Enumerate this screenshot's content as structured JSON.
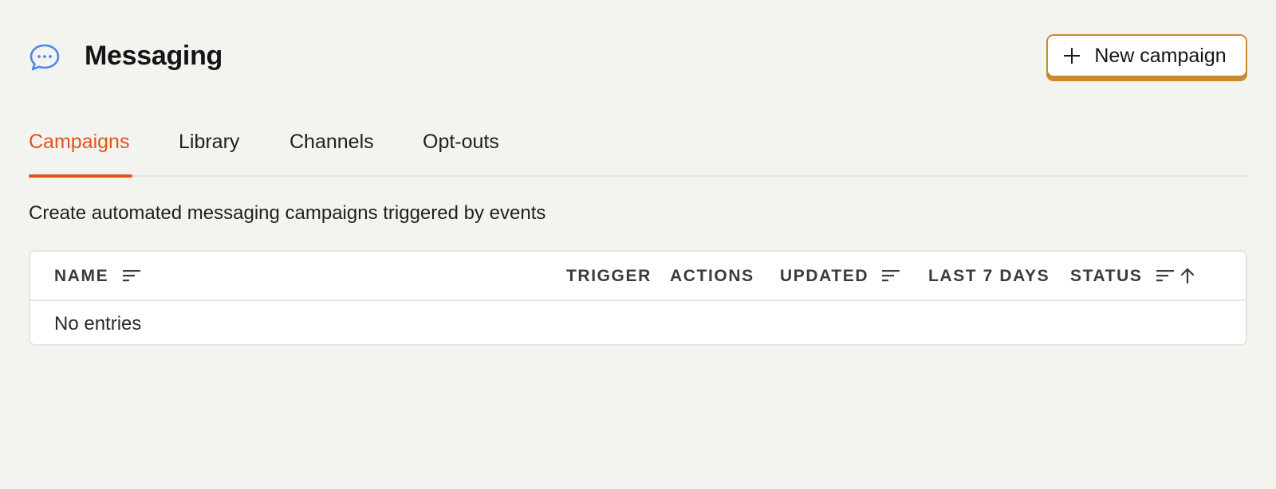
{
  "header": {
    "title": "Messaging",
    "title_icon": "chat-bubble-icon",
    "new_button_label": "New campaign",
    "new_button_icon": "plus-icon"
  },
  "tabs": [
    {
      "label": "Campaigns",
      "active": true
    },
    {
      "label": "Library",
      "active": false
    },
    {
      "label": "Channels",
      "active": false
    },
    {
      "label": "Opt-outs",
      "active": false
    }
  ],
  "description": "Create automated messaging campaigns triggered by events",
  "table": {
    "columns": [
      {
        "label": "NAME",
        "sortable": true
      },
      {
        "label": "TRIGGER",
        "sortable": false
      },
      {
        "label": "ACTIONS",
        "sortable": false
      },
      {
        "label": "UPDATED",
        "sortable": true
      },
      {
        "label": "LAST 7 DAYS",
        "sortable": false
      },
      {
        "label": "STATUS",
        "sortable": true,
        "sort_direction": "ascending"
      }
    ],
    "empty_text": "No entries"
  },
  "colors": {
    "accent": "#e3531d",
    "button_border": "#c98b2c",
    "icon_blue": "#4f86e8",
    "background": "#f3f3ef"
  }
}
